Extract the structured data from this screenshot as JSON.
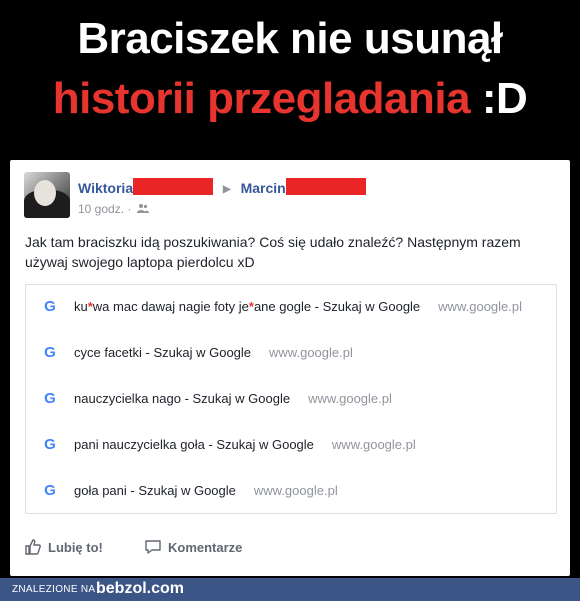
{
  "headline": {
    "line1": "Braciszek nie usunął",
    "line2_red": "historii przegladania",
    "line2_white": ":D"
  },
  "post": {
    "author": "Wiktoria",
    "recipient": "Marcin",
    "time": "10 godz. ·",
    "text": "Jak tam braciszku idą poszukiwania? Coś się udało znaleźć? Następnym razem używaj swojego laptopa pierdolcu xD",
    "redaction_color": "#ea2526"
  },
  "results": [
    {
      "title_a": "ku",
      "title_b": "wa mac dawaj nagie foty je",
      "title_c": "ane gogle - Szukaj w Google",
      "url": "www.google.pl"
    },
    {
      "title": "cyce facetki - Szukaj w Google",
      "url": "www.google.pl"
    },
    {
      "title": "nauczycielka nago - Szukaj w Google",
      "url": "www.google.pl"
    },
    {
      "title": "pani nauczycielka goła - Szukaj w Google",
      "url": "www.google.pl"
    },
    {
      "title": "goła pani - Szukaj w Google",
      "url": "www.google.pl"
    }
  ],
  "actions": {
    "like": "Lubię to!",
    "comment": "Komentarze"
  },
  "footer": {
    "label": "ZNALEZIONE NA",
    "brand": "bebzol.com"
  },
  "colors": {
    "accent_red": "#e8342f",
    "link_blue": "#365899",
    "footer_bg": "#3c5587"
  }
}
